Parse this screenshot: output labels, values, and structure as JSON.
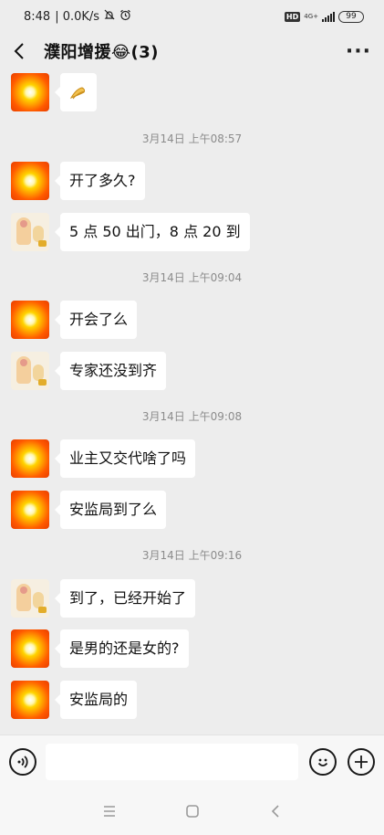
{
  "status_bar": {
    "time": "8:48",
    "network_speed": "| 0.0K/s",
    "hd": "HD",
    "network_type": "4G+",
    "battery": "99"
  },
  "header": {
    "title": "濮阳增援😂(3)",
    "back_icon": "back-arrow-icon",
    "more_icon": "more-dots-icon",
    "more_label": "···"
  },
  "messages": [
    {
      "type": "message",
      "avatar": "sun",
      "text": ""
    },
    {
      "type": "time",
      "text": "3月14日 上午08:57"
    },
    {
      "type": "message",
      "avatar": "sun",
      "text": "开了多久?"
    },
    {
      "type": "message",
      "avatar": "doll",
      "text": "5 点 50 出门，8 点 20 到"
    },
    {
      "type": "time",
      "text": "3月14日 上午09:04"
    },
    {
      "type": "message",
      "avatar": "sun",
      "text": "开会了么"
    },
    {
      "type": "message",
      "avatar": "doll",
      "text": "专家还没到齐"
    },
    {
      "type": "time",
      "text": "3月14日 上午09:08"
    },
    {
      "type": "message",
      "avatar": "sun",
      "text": "业主又交代啥了吗"
    },
    {
      "type": "message",
      "avatar": "sun",
      "text": "安监局到了么"
    },
    {
      "type": "time",
      "text": "3月14日 上午09:16"
    },
    {
      "type": "message",
      "avatar": "doll",
      "text": "到了，已经开始了"
    },
    {
      "type": "message",
      "avatar": "sun",
      "text": "是男的还是女的?"
    },
    {
      "type": "message",
      "avatar": "sun",
      "text": "安监局的"
    }
  ],
  "input_bar": {
    "voice_icon": "voice-icon",
    "input_placeholder": "",
    "emoji_icon": "emoji-icon",
    "plus_icon": "plus-icon"
  },
  "nav_bar": {
    "menu_icon": "menu-icon",
    "home_icon": "home-square-icon",
    "back_icon": "nav-back-icon"
  },
  "colors": {
    "background": "#ededed",
    "bubble": "#ffffff",
    "timestamp": "#8c8c8c"
  }
}
